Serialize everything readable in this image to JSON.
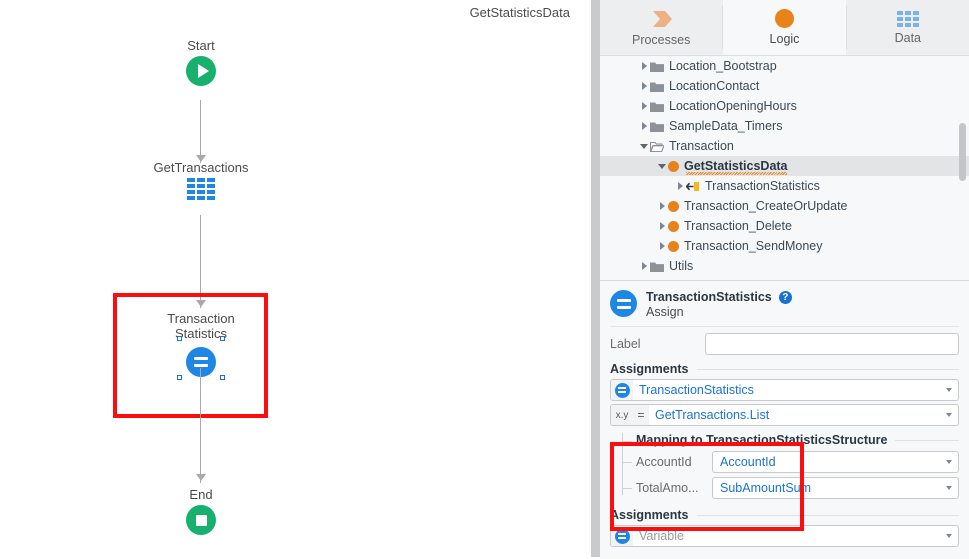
{
  "canvas": {
    "title": "GetStatisticsData",
    "nodes": [
      {
        "label": "Start",
        "icon": "play-circle-icon"
      },
      {
        "label": "GetTransactions",
        "icon": "aggregate-grid-icon"
      },
      {
        "label": "Transaction\nStatistics",
        "icon": "assign-equals-icon"
      },
      {
        "label": "End",
        "icon": "stop-circle-icon"
      }
    ]
  },
  "tabs": [
    {
      "label": "Processes",
      "icon": "process-chevron-icon",
      "active": false
    },
    {
      "label": "Logic",
      "icon": "logic-circle-icon",
      "active": true
    },
    {
      "label": "Data",
      "icon": "data-grid-icon",
      "active": false
    }
  ],
  "tree": {
    "items": [
      {
        "label": "Location_Bootstrap",
        "icon": "folder-icon",
        "indent": 1,
        "expanded": false,
        "selected": false,
        "bold": false
      },
      {
        "label": "LocationContact",
        "icon": "folder-icon",
        "indent": 1,
        "expanded": false,
        "selected": false,
        "bold": false
      },
      {
        "label": "LocationOpeningHours",
        "icon": "folder-icon",
        "indent": 1,
        "expanded": false,
        "selected": false,
        "bold": false
      },
      {
        "label": "SampleData_Timers",
        "icon": "folder-icon",
        "indent": 1,
        "expanded": false,
        "selected": false,
        "bold": false
      },
      {
        "label": "Transaction",
        "icon": "folder-open-icon",
        "indent": 1,
        "expanded": true,
        "selected": false,
        "bold": false
      },
      {
        "label": "GetStatisticsData",
        "icon": "action-dot-icon",
        "indent": 2,
        "expanded": true,
        "selected": true,
        "bold": true,
        "warning": true
      },
      {
        "label": "TransactionStatistics",
        "icon": "input-parameter-icon",
        "indent": 3,
        "expanded": false,
        "selected": false,
        "bold": false
      },
      {
        "label": "Transaction_CreateOrUpdate",
        "icon": "action-dot-icon",
        "indent": 2,
        "expanded": false,
        "selected": false,
        "bold": false
      },
      {
        "label": "Transaction_Delete",
        "icon": "action-dot-icon",
        "indent": 2,
        "expanded": false,
        "selected": false,
        "bold": false
      },
      {
        "label": "Transaction_SendMoney",
        "icon": "action-dot-icon",
        "indent": 2,
        "expanded": false,
        "selected": false,
        "bold": false
      },
      {
        "label": "Utils",
        "icon": "folder-icon",
        "indent": 1,
        "expanded": false,
        "selected": false,
        "bold": false
      }
    ]
  },
  "properties": {
    "header": {
      "title": "TransactionStatistics",
      "subtitle": "Assign",
      "help_icon_label": "?"
    },
    "label_field": {
      "label": "Label",
      "value": "",
      "placeholder": ""
    },
    "assignments_section_1": {
      "title": "Assignments",
      "rows": [
        {
          "badge": "assign-circle-icon",
          "operator": "",
          "value": "TransactionStatistics",
          "placeholder": false
        },
        {
          "badge": "xy-variable-icon",
          "badge_text": "x.y",
          "operator": "=",
          "value": "GetTransactions.List",
          "placeholder": false
        }
      ]
    },
    "mapping": {
      "title": "Mapping to TransactionStatisticsStructure",
      "rows": [
        {
          "label": "AccountId",
          "value": "AccountId"
        },
        {
          "label": "TotalAmo...",
          "value": "SubAmountSum"
        }
      ]
    },
    "assignments_section_2": {
      "title": "Assignments",
      "rows": [
        {
          "badge": "assign-circle-icon",
          "operator": "",
          "value": "Variable",
          "placeholder": true
        }
      ]
    }
  },
  "colors": {
    "accent_blue": "#1e87e5",
    "green": "#18b06d",
    "orange": "#e8821a",
    "highlight_red": "#fd0e0e",
    "link_blue": "#1a73d4"
  }
}
